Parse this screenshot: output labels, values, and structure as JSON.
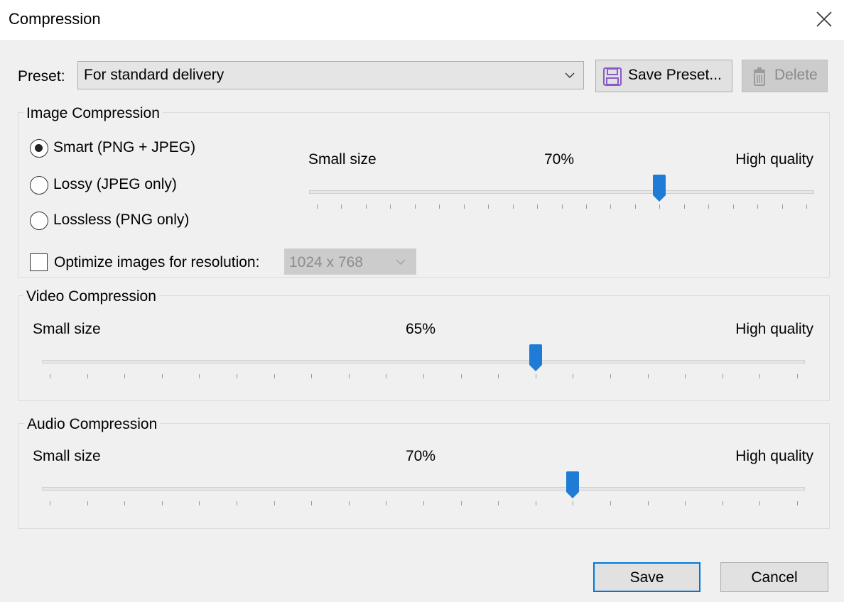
{
  "window": {
    "title": "Compression"
  },
  "preset": {
    "label": "Preset:",
    "selected": "For standard delivery",
    "save_label": "Save Preset...",
    "delete_label": "Delete"
  },
  "image_compression": {
    "title": "Image Compression",
    "options": [
      {
        "label": "Smart (PNG + JPEG)",
        "selected": true
      },
      {
        "label": "Lossy (JPEG only)",
        "selected": false
      },
      {
        "label": "Lossless (PNG only)",
        "selected": false
      }
    ],
    "optimize_label": "Optimize images for resolution:",
    "optimize_checked": false,
    "resolution": "1024 x 768",
    "slider": {
      "min_label": "Small size",
      "max_label": "High quality",
      "value_text": "70%",
      "value": 70
    }
  },
  "video_compression": {
    "title": "Video Compression",
    "slider": {
      "min_label": "Small size",
      "max_label": "High quality",
      "value_text": "65%",
      "value": 65
    }
  },
  "audio_compression": {
    "title": "Audio Compression",
    "slider": {
      "min_label": "Small size",
      "max_label": "High quality",
      "value_text": "70%",
      "value": 70
    }
  },
  "footer": {
    "save_label": "Save",
    "cancel_label": "Cancel"
  },
  "colors": {
    "accent": "#0078d7",
    "thumb": "#1e7bd6"
  }
}
